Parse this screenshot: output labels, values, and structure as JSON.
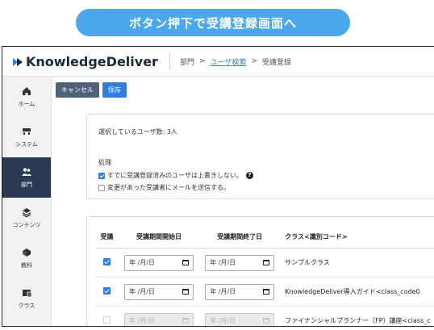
{
  "banner": {
    "text": "ボタン押下で受講登録画面へ"
  },
  "app": {
    "logo": "KnowledgeDeliver"
  },
  "breadcrumb": {
    "item1": "部門",
    "sep1": ">",
    "item2": "ユーザ検索",
    "sep2": ">",
    "item3": "受講登録"
  },
  "sidebar": {
    "items": [
      {
        "label": "ホーム",
        "icon": "home-icon"
      },
      {
        "label": "システム",
        "icon": "system-icon"
      },
      {
        "label": "部門",
        "icon": "users-icon",
        "active": true
      },
      {
        "label": "コンテンツ",
        "icon": "layers-icon"
      },
      {
        "label": "教科",
        "icon": "book-icon"
      },
      {
        "label": "クラス",
        "icon": "class-icon"
      }
    ]
  },
  "toolbar": {
    "cancel_label": "キャンセル",
    "save_label": "保存"
  },
  "selection": {
    "count_text": "選択しているユーザ数: 3人"
  },
  "processing": {
    "heading": "処理",
    "option1": "すでに受講登録済みのユーザは上書きしない。",
    "option1_checked": true,
    "option2": "変更があった受講者にメールを送信する。",
    "option2_checked": false
  },
  "table": {
    "headers": {
      "enroll": "受講",
      "start": "受講期間開始日",
      "end": "受講期間終了日",
      "class": "クラス<識別コード>"
    },
    "date_placeholder": "年 /月/日",
    "rows": [
      {
        "checked": true,
        "disabled": false,
        "class_name": "サンプルクラス"
      },
      {
        "checked": true,
        "disabled": false,
        "class_name": "KnowledgeDeliver導入ガイド<class_code0"
      },
      {
        "checked": false,
        "disabled": true,
        "class_name": "ファイナンシャルプランナー（FP）講座<class_c"
      }
    ]
  },
  "colors": {
    "banner": "#4ca8ec",
    "sidebar_active": "#2a3a52",
    "primary": "#2f7fe3",
    "cancel": "#4f6178"
  }
}
